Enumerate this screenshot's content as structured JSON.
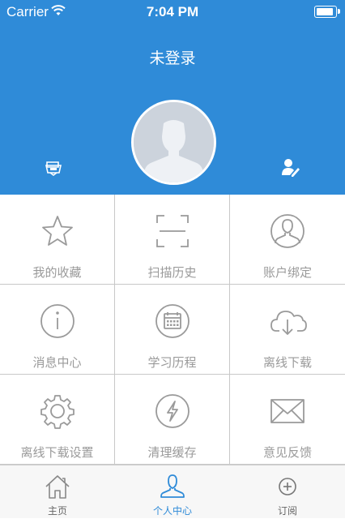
{
  "status_bar": {
    "carrier": "Carrier",
    "time": "7:04 PM",
    "battery_level": 0.9
  },
  "header": {
    "title": "未登录"
  },
  "grid": {
    "items": [
      {
        "label": "我的收藏",
        "icon": "star-icon"
      },
      {
        "label": "扫描历史",
        "icon": "scan-frame-icon"
      },
      {
        "label": "账户绑定",
        "icon": "user-circle-icon"
      },
      {
        "label": "消息中心",
        "icon": "info-circle-icon"
      },
      {
        "label": "学习历程",
        "icon": "calendar-circle-icon"
      },
      {
        "label": "离线下载",
        "icon": "cloud-download-icon"
      },
      {
        "label": "离线下载设置",
        "icon": "gear-icon"
      },
      {
        "label": "清理缓存",
        "icon": "lightning-circle-icon"
      },
      {
        "label": "意见反馈",
        "icon": "envelope-icon"
      }
    ]
  },
  "tabbar": {
    "items": [
      {
        "label": "主页",
        "icon": "home-icon",
        "active": false
      },
      {
        "label": "个人中心",
        "icon": "person-icon",
        "active": true
      },
      {
        "label": "订阅",
        "icon": "plus-circle-icon",
        "active": false
      }
    ]
  },
  "colors": {
    "accent": "#2f8bd8",
    "grid_icon": "#9a9a9a",
    "grid_border": "#c8c8c8",
    "tabbar_bg": "#f7f7f7"
  }
}
